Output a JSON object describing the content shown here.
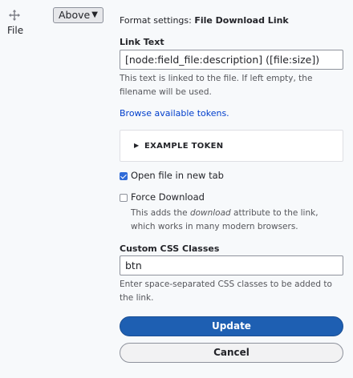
{
  "row": {
    "drag_icon": "four-way-arrow-icon",
    "field_name": "File",
    "label_display": "Above"
  },
  "format": {
    "title_prefix": "Format settings: ",
    "title_name": "File Download Link",
    "link_text": {
      "label": "Link Text",
      "value": "[node:field_file:description] ([file:size])",
      "description": "This text is linked to the file. If left empty, the filename will be used."
    },
    "browse_tokens": "Browse available tokens.",
    "example_token": "EXAMPLE TOKEN",
    "open_new_tab": {
      "label": "Open file in new tab",
      "checked": true
    },
    "force_download": {
      "label": "Force Download",
      "checked": false,
      "desc_before": "This adds the ",
      "desc_em": "download",
      "desc_after": " attribute to the link, which works in many modern browsers."
    },
    "css_classes": {
      "label": "Custom CSS Classes",
      "value": "btn",
      "description": "Enter space-separated CSS classes to be added to the link."
    },
    "update_label": "Update",
    "cancel_label": "Cancel"
  },
  "colors": {
    "primary_button": "#1e5fb2",
    "link": "#003ecc",
    "checkbox_checked": "#2f6bd8"
  }
}
